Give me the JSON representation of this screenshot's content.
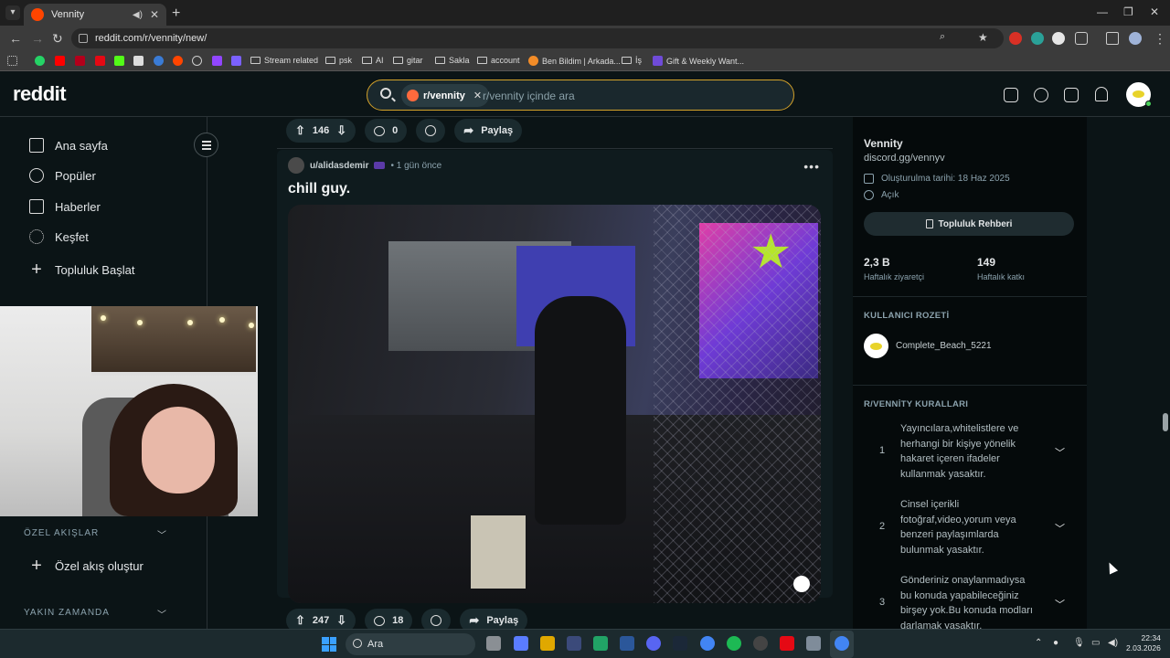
{
  "browser": {
    "tab_title": "Vennity",
    "url": "reddit.com/r/vennity/new/",
    "bookmarks": [
      "Stream related",
      "psk",
      "AI",
      "gitar",
      "Sakla",
      "account",
      "Ben Bildim | Arkada...",
      "İş",
      "Gift & Weekly Want..."
    ]
  },
  "header": {
    "logo": "reddit",
    "search_chip": "r/vennity",
    "search_placeholder": "r/vennity içinde ara"
  },
  "sidebar": {
    "items": [
      {
        "label": "Ana sayfa",
        "icon": "home-icon"
      },
      {
        "label": "Popüler",
        "icon": "popular-icon"
      },
      {
        "label": "Haberler",
        "icon": "news-icon"
      },
      {
        "label": "Keşfet",
        "icon": "explore-icon"
      },
      {
        "label": "Topluluk Başlat",
        "icon": "plus-icon"
      }
    ],
    "custom_feeds_heading": "ÖZEL AKIŞLAR",
    "create_feed_label": "Özel akış oluştur",
    "recent_heading": "YAKIN ZAMANDA"
  },
  "feed": {
    "prev_post": {
      "votes": "146",
      "comments": "0",
      "share": "Paylaş"
    },
    "post": {
      "author": "u/alidasdemir",
      "time": "• 1 gün önce",
      "title": "chill guy.",
      "votes": "247",
      "comments": "18",
      "share": "Paylaş"
    }
  },
  "community": {
    "name": "Vennity",
    "discord": "discord.gg/vennyv",
    "created": "Oluşturulma tarihi: 18 Haz 2025",
    "visibility": "Açık",
    "guide_button": "Topluluk Rehberi",
    "stats": [
      {
        "value": "2,3 B",
        "label": "Haftalık ziyaretçi"
      },
      {
        "value": "149",
        "label": "Haftalık katkı"
      }
    ],
    "badge_heading": "KULLANICI ROZETİ",
    "badge_user": "Complete_Beach_5221",
    "rules_heading": "R/VENNİTY KURALLARI",
    "rules": [
      {
        "num": "1",
        "text": "Yayıncılara,whitelistlere ve herhangi bir kişiye yönelik hakaret içeren ifadeler kullanmak yasaktır."
      },
      {
        "num": "2",
        "text": "Cinsel içerikli fotoğraf,video,yorum veya benzeri paylaşımlarda bulunmak yasaktır."
      },
      {
        "num": "3",
        "text": "Gönderiniz onaylanmadıysa bu konuda yapabileceğiniz birşey yok.Bu konuda modları darlamak yasaktır."
      }
    ]
  },
  "taskbar": {
    "search_label": "Ara",
    "time": "22:34",
    "date": "2.03.2026"
  },
  "colors": {
    "background": "#0b1416",
    "search_border": "#d4a22a",
    "reddit_orange": "#ff4500"
  }
}
